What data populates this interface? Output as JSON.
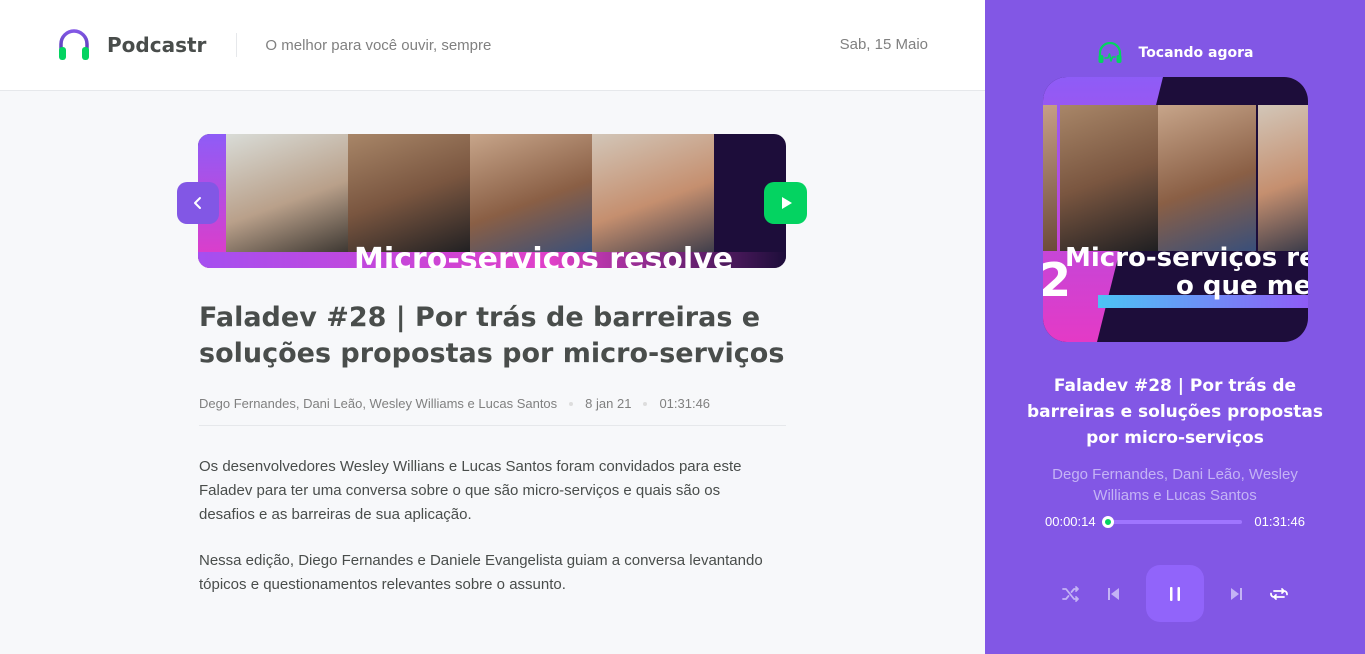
{
  "header": {
    "app_name": "Podcastr",
    "tagline": "O melhor para você ouvir, sempre",
    "date": "Sab, 15 Maio"
  },
  "episode": {
    "thumbnail_text": "Micro-serviços resolve",
    "title": "Faladev #28 | Por trás de barreiras e soluções propostas por micro-serviços",
    "members": "Dego Fernandes, Dani Leão, Wesley Williams e Lucas Santos",
    "published_at": "8 jan 21",
    "duration": "01:31:46",
    "description": [
      "Os desenvolvedores Wesley Willians e Lucas Santos foram convidados para este Faladev para ter uma conversa sobre o que são micro-serviços e quais são os desafios e as barreiras de sua aplicação.",
      "Nessa edição, Diego Fernandes e Daniele Evangelista guiam a conversa levantando tópicos e questionamentos relevantes sobre o assunto."
    ]
  },
  "player": {
    "label": "Tocando agora",
    "cover_text_line1": "Micro-serviços re",
    "cover_text_line2": "o que me",
    "cover_number": "2",
    "title": "Faladev #28 | Por trás de barreiras e soluções propostas por micro-serviços",
    "members": "Dego Fernandes, Dani Leão, Wesley Williams e Lucas Santos",
    "current_time": "00:00:14",
    "total_time": "01:31:46",
    "progress": 0.003
  },
  "icons": {
    "logo": "headphones-icon",
    "back": "chevron-left-icon",
    "play": "play-icon",
    "now_playing": "playing-headphones-icon",
    "shuffle": "shuffle-icon",
    "previous": "skip-back-icon",
    "pause": "pause-icon",
    "next": "skip-forward-icon",
    "repeat": "repeat-icon"
  },
  "colors": {
    "primary": "#8257e5",
    "green": "#04d361",
    "text": "#494d4b",
    "muted": "#808080"
  }
}
